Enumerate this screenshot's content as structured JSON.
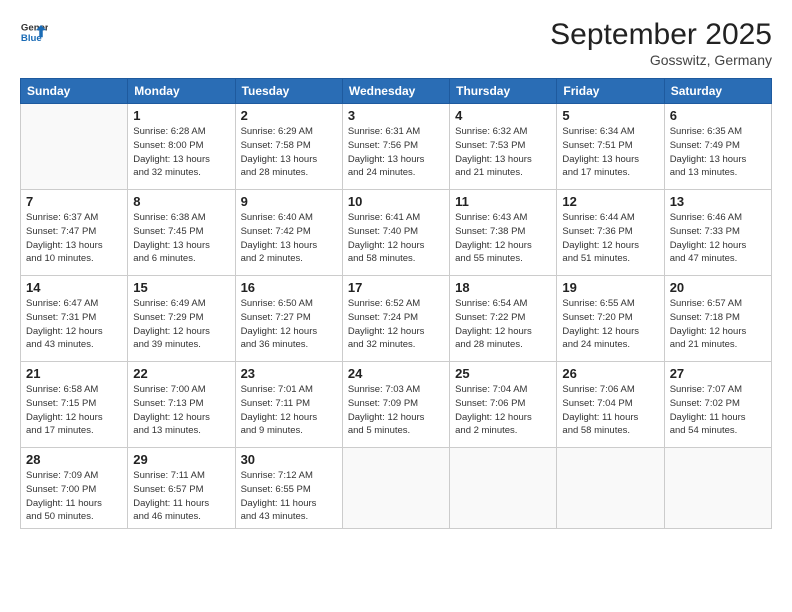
{
  "logo": {
    "line1": "General",
    "line2": "Blue"
  },
  "title": "September 2025",
  "location": "Gosswitz, Germany",
  "weekdays": [
    "Sunday",
    "Monday",
    "Tuesday",
    "Wednesday",
    "Thursday",
    "Friday",
    "Saturday"
  ],
  "weeks": [
    [
      {
        "day": "",
        "info": ""
      },
      {
        "day": "1",
        "info": "Sunrise: 6:28 AM\nSunset: 8:00 PM\nDaylight: 13 hours\nand 32 minutes."
      },
      {
        "day": "2",
        "info": "Sunrise: 6:29 AM\nSunset: 7:58 PM\nDaylight: 13 hours\nand 28 minutes."
      },
      {
        "day": "3",
        "info": "Sunrise: 6:31 AM\nSunset: 7:56 PM\nDaylight: 13 hours\nand 24 minutes."
      },
      {
        "day": "4",
        "info": "Sunrise: 6:32 AM\nSunset: 7:53 PM\nDaylight: 13 hours\nand 21 minutes."
      },
      {
        "day": "5",
        "info": "Sunrise: 6:34 AM\nSunset: 7:51 PM\nDaylight: 13 hours\nand 17 minutes."
      },
      {
        "day": "6",
        "info": "Sunrise: 6:35 AM\nSunset: 7:49 PM\nDaylight: 13 hours\nand 13 minutes."
      }
    ],
    [
      {
        "day": "7",
        "info": "Sunrise: 6:37 AM\nSunset: 7:47 PM\nDaylight: 13 hours\nand 10 minutes."
      },
      {
        "day": "8",
        "info": "Sunrise: 6:38 AM\nSunset: 7:45 PM\nDaylight: 13 hours\nand 6 minutes."
      },
      {
        "day": "9",
        "info": "Sunrise: 6:40 AM\nSunset: 7:42 PM\nDaylight: 13 hours\nand 2 minutes."
      },
      {
        "day": "10",
        "info": "Sunrise: 6:41 AM\nSunset: 7:40 PM\nDaylight: 12 hours\nand 58 minutes."
      },
      {
        "day": "11",
        "info": "Sunrise: 6:43 AM\nSunset: 7:38 PM\nDaylight: 12 hours\nand 55 minutes."
      },
      {
        "day": "12",
        "info": "Sunrise: 6:44 AM\nSunset: 7:36 PM\nDaylight: 12 hours\nand 51 minutes."
      },
      {
        "day": "13",
        "info": "Sunrise: 6:46 AM\nSunset: 7:33 PM\nDaylight: 12 hours\nand 47 minutes."
      }
    ],
    [
      {
        "day": "14",
        "info": "Sunrise: 6:47 AM\nSunset: 7:31 PM\nDaylight: 12 hours\nand 43 minutes."
      },
      {
        "day": "15",
        "info": "Sunrise: 6:49 AM\nSunset: 7:29 PM\nDaylight: 12 hours\nand 39 minutes."
      },
      {
        "day": "16",
        "info": "Sunrise: 6:50 AM\nSunset: 7:27 PM\nDaylight: 12 hours\nand 36 minutes."
      },
      {
        "day": "17",
        "info": "Sunrise: 6:52 AM\nSunset: 7:24 PM\nDaylight: 12 hours\nand 32 minutes."
      },
      {
        "day": "18",
        "info": "Sunrise: 6:54 AM\nSunset: 7:22 PM\nDaylight: 12 hours\nand 28 minutes."
      },
      {
        "day": "19",
        "info": "Sunrise: 6:55 AM\nSunset: 7:20 PM\nDaylight: 12 hours\nand 24 minutes."
      },
      {
        "day": "20",
        "info": "Sunrise: 6:57 AM\nSunset: 7:18 PM\nDaylight: 12 hours\nand 21 minutes."
      }
    ],
    [
      {
        "day": "21",
        "info": "Sunrise: 6:58 AM\nSunset: 7:15 PM\nDaylight: 12 hours\nand 17 minutes."
      },
      {
        "day": "22",
        "info": "Sunrise: 7:00 AM\nSunset: 7:13 PM\nDaylight: 12 hours\nand 13 minutes."
      },
      {
        "day": "23",
        "info": "Sunrise: 7:01 AM\nSunset: 7:11 PM\nDaylight: 12 hours\nand 9 minutes."
      },
      {
        "day": "24",
        "info": "Sunrise: 7:03 AM\nSunset: 7:09 PM\nDaylight: 12 hours\nand 5 minutes."
      },
      {
        "day": "25",
        "info": "Sunrise: 7:04 AM\nSunset: 7:06 PM\nDaylight: 12 hours\nand 2 minutes."
      },
      {
        "day": "26",
        "info": "Sunrise: 7:06 AM\nSunset: 7:04 PM\nDaylight: 11 hours\nand 58 minutes."
      },
      {
        "day": "27",
        "info": "Sunrise: 7:07 AM\nSunset: 7:02 PM\nDaylight: 11 hours\nand 54 minutes."
      }
    ],
    [
      {
        "day": "28",
        "info": "Sunrise: 7:09 AM\nSunset: 7:00 PM\nDaylight: 11 hours\nand 50 minutes."
      },
      {
        "day": "29",
        "info": "Sunrise: 7:11 AM\nSunset: 6:57 PM\nDaylight: 11 hours\nand 46 minutes."
      },
      {
        "day": "30",
        "info": "Sunrise: 7:12 AM\nSunset: 6:55 PM\nDaylight: 11 hours\nand 43 minutes."
      },
      {
        "day": "",
        "info": ""
      },
      {
        "day": "",
        "info": ""
      },
      {
        "day": "",
        "info": ""
      },
      {
        "day": "",
        "info": ""
      }
    ]
  ]
}
